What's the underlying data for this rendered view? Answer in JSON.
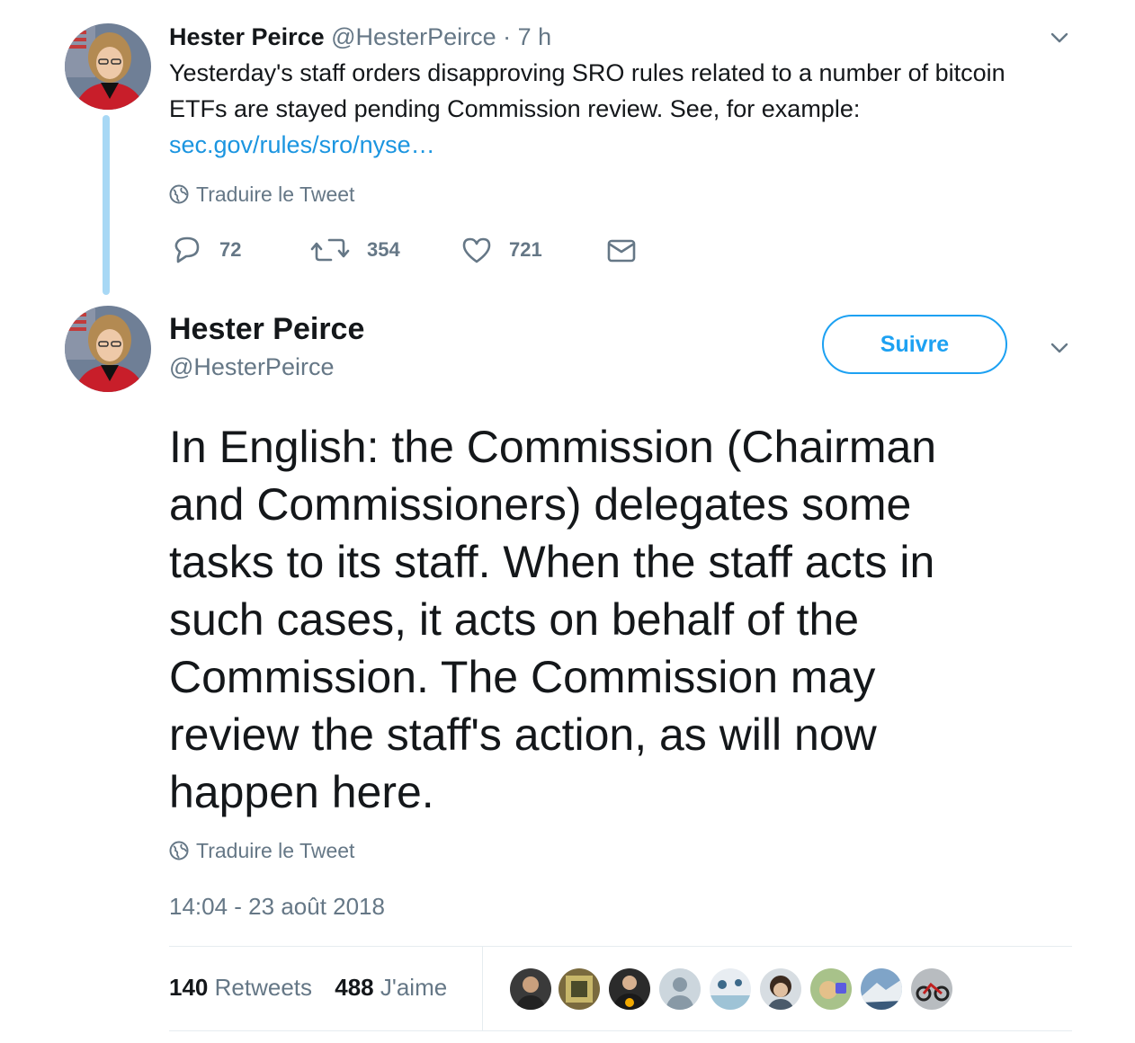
{
  "tweet_parent": {
    "author_name": "Hester Peirce",
    "author_handle": "@HesterPeirce",
    "separator": "·",
    "time": "7 h",
    "text_lines": [
      "Yesterday's staff orders disapproving SRO rules related to a number of bitcoin",
      "ETFs are stayed pending Commission review.  See, for example:"
    ],
    "link": "sec.gov/rules/sro/nyse…",
    "translate_label": "Traduire le Tweet",
    "reply_count": "72",
    "retweet_count": "354",
    "like_count": "721"
  },
  "tweet_main": {
    "author_name": "Hester Peirce",
    "author_handle": "@HesterPeirce",
    "follow_label": "Suivre",
    "text_lines": [
      "In English: the Commission (Chairman",
      "and Commissioners) delegates some",
      "tasks to its staff.  When the staff acts in",
      "such cases, it acts on behalf of the",
      "Commission.  The Commission may",
      "review the staff's action, as will now",
      "happen here."
    ],
    "translate_label": "Traduire le Tweet",
    "timestamp": "14:04 - 23 août 2018",
    "retweets_count": "140",
    "retweets_label": "Retweets",
    "likes_count": "488",
    "likes_label": "J'aime"
  },
  "colors": {
    "accent": "#1da1f2",
    "link": "#1b95e0",
    "muted": "#657786",
    "text": "#14171a",
    "thread_line": "#a8d8f5"
  },
  "icons": [
    "globe-icon",
    "chevron-down-icon",
    "reply-icon",
    "retweet-icon",
    "heart-icon",
    "message-icon"
  ],
  "liker_avatars": 9
}
